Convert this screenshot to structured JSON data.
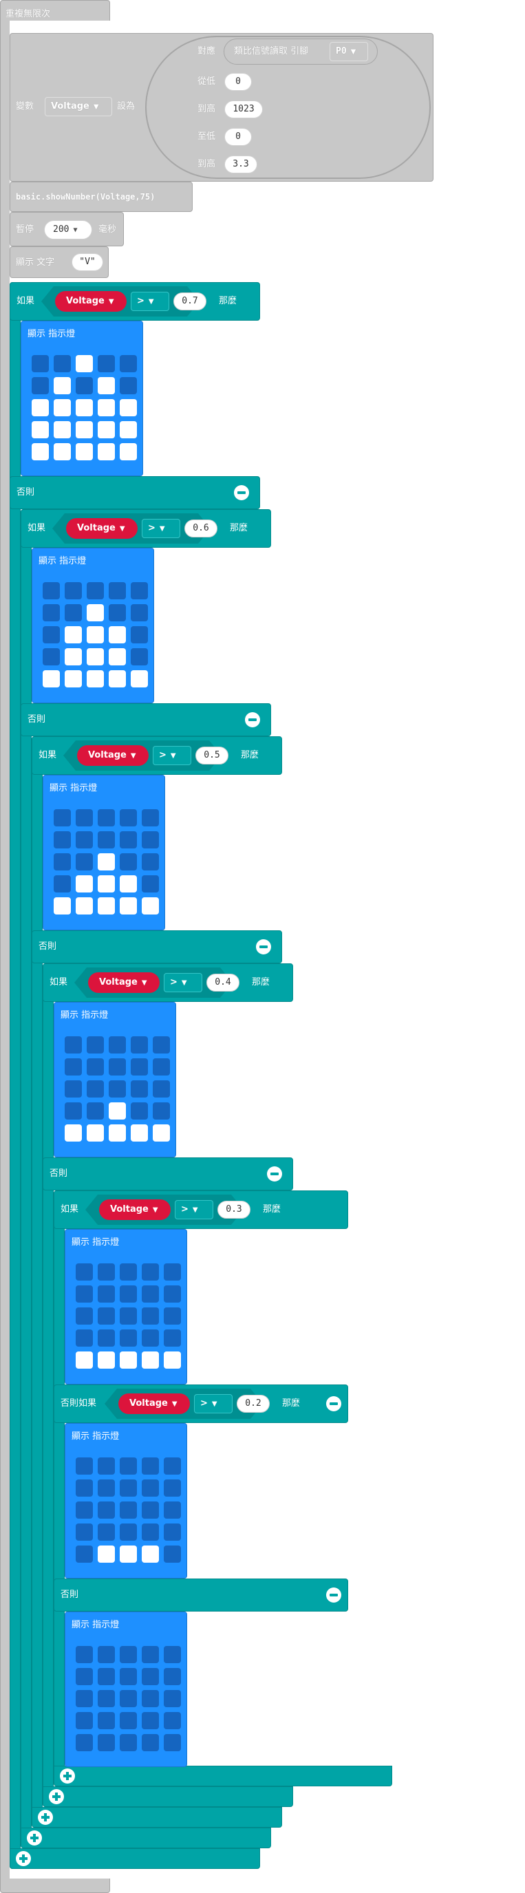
{
  "forever": {
    "label": "重複無限次"
  },
  "set_var": {
    "prefix": "變數",
    "variable": "Voltage",
    "suffix": "設為",
    "map_fn": "對應",
    "analog_read": "類比信號讀取 引腳",
    "pin": "P0",
    "from_low_label": "從低",
    "from_low": "0",
    "from_high_label": "到高",
    "from_high": "1023",
    "to_low_label": "至低",
    "to_low": "0",
    "to_high_label": "到高",
    "to_high": "3.3"
  },
  "show_number": {
    "code": "basic.showNumber(Voltage,75)"
  },
  "pause": {
    "prefix": "暫停",
    "value": "200",
    "suffix": "毫秒"
  },
  "show_string": {
    "prefix": "顯示 文字",
    "value": "\"V\""
  },
  "labels": {
    "if": "如果",
    "then": "那麼",
    "else": "否則",
    "else_if": "否則如果",
    "show_leds": "顯示 指示燈",
    "operator": ">",
    "variable": "Voltage"
  },
  "conditions": [
    "0.7",
    "0.6",
    "0.5",
    "0.4",
    "0.3",
    "0.2"
  ],
  "led_patterns": [
    [
      "00100",
      "01010",
      "11111",
      "11111",
      "11111"
    ],
    [
      "00000",
      "00100",
      "01110",
      "01110",
      "11111"
    ],
    [
      "00000",
      "00000",
      "00100",
      "01110",
      "11111"
    ],
    [
      "00000",
      "00000",
      "00000",
      "00100",
      "11111"
    ],
    [
      "00000",
      "00000",
      "00000",
      "00000",
      "11111"
    ],
    [
      "00000",
      "00000",
      "00000",
      "00000",
      "01110"
    ],
    [
      "00000",
      "00000",
      "00000",
      "00000",
      "00000"
    ]
  ]
}
